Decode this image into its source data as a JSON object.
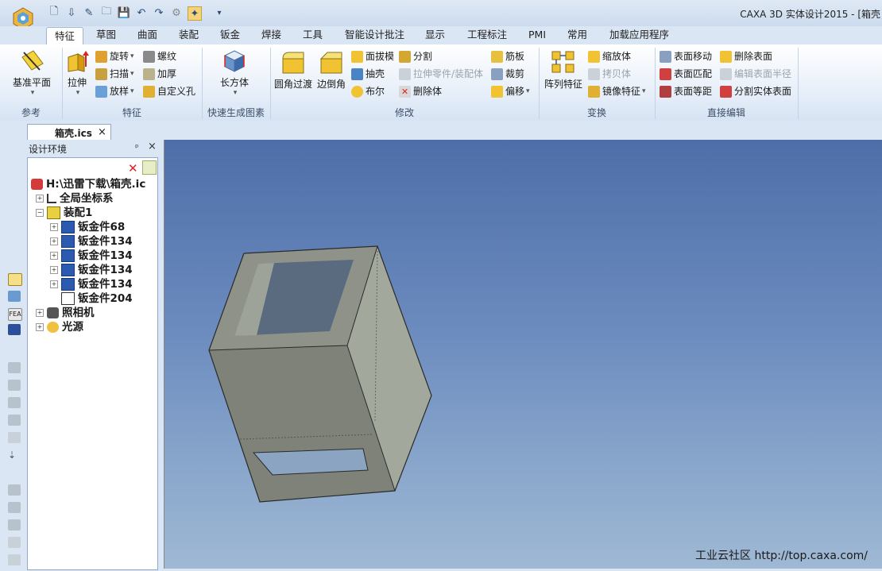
{
  "window": {
    "title": "CAXA 3D 实体设计2015 - [箱壳",
    "quick_access": [
      "new-icon",
      "open-drop-icon",
      "edit-icon",
      "folder-icon",
      "save-icon",
      "undo-icon",
      "redo-icon",
      "gear-icon",
      "wizard-icon",
      "dropdown-icon"
    ]
  },
  "tabs": [
    "特征",
    "草图",
    "曲面",
    "装配",
    "钣金",
    "焊接",
    "工具",
    "智能设计批注",
    "显示",
    "工程标注",
    "PMI",
    "常用",
    "加载应用程序"
  ],
  "ribbon": {
    "groups": {
      "reference": "参考",
      "feature": "特征",
      "quick_shape": "快速生成图素",
      "modify": "修改",
      "transform": "变换",
      "direct_edit": "直接编辑"
    },
    "ref_plane": "基准平面",
    "extrude": "拉伸",
    "revolve": "旋转",
    "sweep": "扫描",
    "loft": "放样",
    "thread": "螺纹",
    "thicken": "加厚",
    "custom_hole": "自定义孔",
    "box": "长方体",
    "fillet": "圆角过渡",
    "chamfer": "边倒角",
    "draft": "面拔模",
    "shell": "抽壳",
    "boolean": "布尔",
    "split": "分割",
    "extrude_part": "拉伸零件/装配体",
    "delete_body": "删除体",
    "rib": "筋板",
    "trim": "裁剪",
    "offset": "偏移",
    "pattern": "阵列特征",
    "scale": "缩放体",
    "copy": "拷贝体",
    "mirror": "镜像特征",
    "face_move": "表面移动",
    "face_match": "表面匹配",
    "face_offset": "表面等距",
    "delete_face": "删除表面",
    "edit_face_radius": "编辑表面半径",
    "split_face": "分割实体表面"
  },
  "document_tab": "箱壳.ics",
  "panel": {
    "title": "设计环境",
    "pin": "ᵖ",
    "close": "×"
  },
  "tree": [
    {
      "label": "H:\\迅雷下载\\箱壳.ic",
      "level": 0
    },
    {
      "label": "全局坐标系",
      "level": 1
    },
    {
      "label": "装配1",
      "level": 1
    },
    {
      "label": "钣金件68",
      "level": 2
    },
    {
      "label": "钣金件134",
      "level": 2
    },
    {
      "label": "钣金件134",
      "level": 2
    },
    {
      "label": "钣金件134",
      "level": 2
    },
    {
      "label": "钣金件134",
      "level": 2
    },
    {
      "label": "钣金件204",
      "level": 2
    },
    {
      "label": "照相机",
      "level": 1
    },
    {
      "label": "光源",
      "level": 1
    }
  ],
  "watermark": "工业云社区 http://top.caxa.com/",
  "colors": {
    "viewport_top": "#4d6ea8",
    "viewport_bottom": "#9fb9d4",
    "model_face_front": "#7f8279",
    "model_face_side": "#a3a89c",
    "model_face_top": "#8e9289"
  }
}
